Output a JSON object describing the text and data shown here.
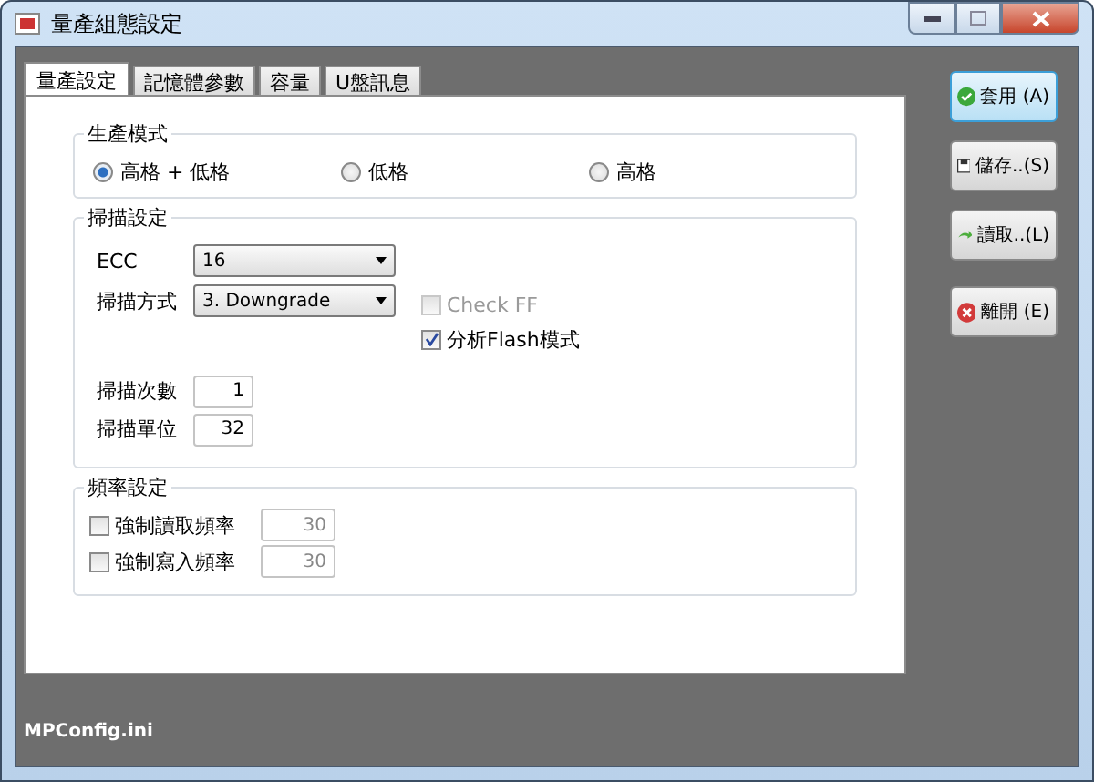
{
  "window": {
    "title": "量產組態設定"
  },
  "tabs": [
    {
      "label": "量產設定",
      "selected": true
    },
    {
      "label": "記憶體參數",
      "selected": false
    },
    {
      "label": "容量",
      "selected": false
    },
    {
      "label": "U盤訊息",
      "selected": false
    }
  ],
  "production_mode": {
    "title": "生產模式",
    "options": [
      {
        "label": "高格 + 低格",
        "selected": true
      },
      {
        "label": "低格",
        "selected": false
      },
      {
        "label": "高格",
        "selected": false
      }
    ]
  },
  "scan_settings": {
    "title": "掃描設定",
    "ecc": {
      "label": "ECC",
      "value": "16"
    },
    "scan_method": {
      "label": "掃描方式",
      "value": "3. Downgrade"
    },
    "checks": [
      {
        "label": "Check FF",
        "checked": false,
        "disabled": true
      },
      {
        "label": "分析Flash模式",
        "checked": true,
        "disabled": false
      }
    ],
    "scan_count": {
      "label": "掃描次數",
      "value": "1"
    },
    "scan_unit": {
      "label": "掃描單位",
      "value": "32"
    }
  },
  "frequency": {
    "title": "頻率設定",
    "rows": [
      {
        "label": "強制讀取頻率",
        "checked": false,
        "value": "30",
        "field_disabled": true
      },
      {
        "label": "強制寫入頻率",
        "checked": false,
        "value": "30",
        "field_disabled": true
      }
    ]
  },
  "buttons": [
    {
      "label": "套用 (A)",
      "kind": "apply",
      "focused": true
    },
    {
      "label": "儲存..(S)",
      "kind": "save",
      "focused": false
    },
    {
      "label": "讀取..(L)",
      "kind": "load",
      "focused": false
    },
    {
      "label": "離開 (E)",
      "kind": "exit",
      "focused": false
    }
  ],
  "status_bar": {
    "text": "MPConfig.ini"
  }
}
